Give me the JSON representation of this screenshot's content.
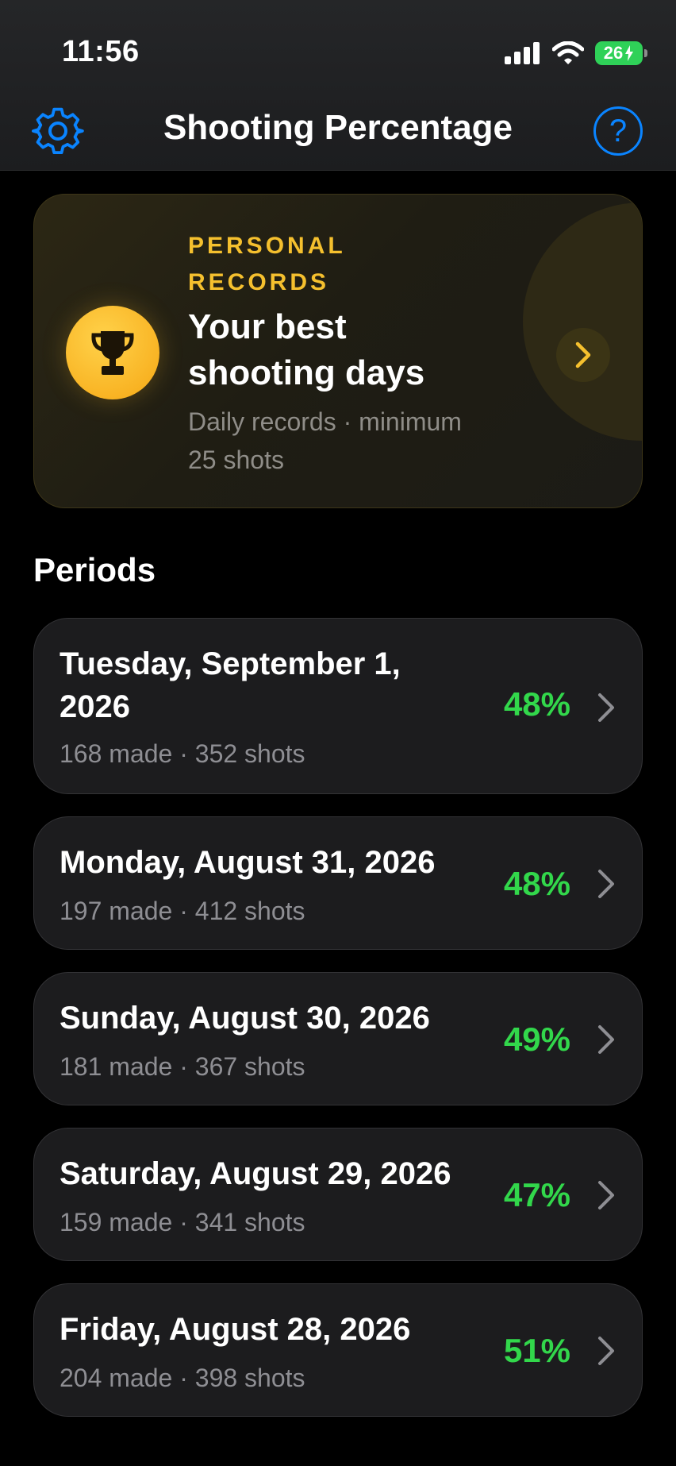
{
  "status_bar": {
    "time": "11:56",
    "battery": "26"
  },
  "nav": {
    "title": "Shooting Percentage",
    "help_label": "?"
  },
  "records": {
    "eyebrow": "PERSONAL RECORDS",
    "title": "Your best shooting days",
    "subtitle": "Daily records · minimum 25 shots"
  },
  "section_title": "Periods",
  "periods": [
    {
      "date": "Tuesday, September 1, 2026",
      "made": "168 made",
      "shots": "352 shots",
      "percent": "48%"
    },
    {
      "date": "Monday, August 31, 2026",
      "made": "197 made",
      "shots": "412 shots",
      "percent": "48%"
    },
    {
      "date": "Sunday, August 30, 2026",
      "made": "181 made",
      "shots": "367 shots",
      "percent": "49%"
    },
    {
      "date": "Saturday, August 29, 2026",
      "made": "159 made",
      "shots": "341 shots",
      "percent": "47%"
    },
    {
      "date": "Friday, August 28, 2026",
      "made": "204 made",
      "shots": "398 shots",
      "percent": "51%"
    }
  ],
  "colors": {
    "accent": "#0a84ff",
    "gold": "#f5c02e",
    "positive": "#32d74b",
    "background": "#000000",
    "card": "#1c1c1e"
  }
}
